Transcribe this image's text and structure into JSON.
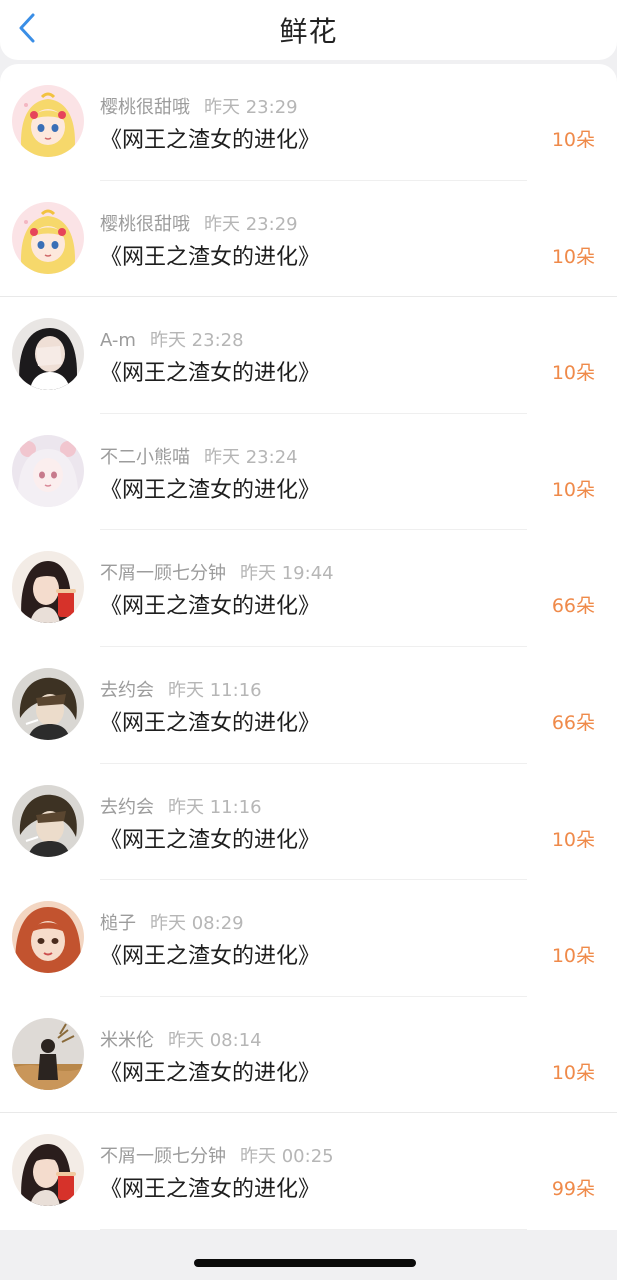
{
  "header": {
    "title": "鲜花",
    "back_icon": "chevron-left-icon",
    "accent": "#3a8ee6"
  },
  "colors": {
    "count": "#ef8a4a",
    "meta": "#9c9c9c"
  },
  "rows": [
    {
      "user": "樱桃很甜哦",
      "time": "昨天 23:29",
      "book": "《网王之渣女的进化》",
      "count": "10朵",
      "avatar": "anime-blonde-girl-avatar"
    },
    {
      "user": "樱桃很甜哦",
      "time": "昨天 23:29",
      "book": "《网王之渣女的进化》",
      "count": "10朵",
      "avatar": "anime-blonde-girl-avatar"
    },
    {
      "user": "A-m",
      "time": "昨天 23:28",
      "book": "《网王之渣女的进化》",
      "count": "10朵",
      "avatar": "girl-covering-face-avatar"
    },
    {
      "user": "不二小熊喵",
      "time": "昨天 23:24",
      "book": "《网王之渣女的进化》",
      "count": "10朵",
      "avatar": "pastel-anime-girl-avatar"
    },
    {
      "user": "不屑一顾七分钟",
      "time": "昨天 19:44",
      "book": "《网王之渣女的进化》",
      "count": "66朵",
      "avatar": "girl-with-drink-avatar"
    },
    {
      "user": "去约会",
      "time": "昨天 11:16",
      "book": "《网王之渣女的进化》",
      "count": "66朵",
      "avatar": "anime-man-avatar"
    },
    {
      "user": "去约会",
      "time": "昨天 11:16",
      "book": "《网王之渣女的进化》",
      "count": "10朵",
      "avatar": "anime-man-avatar"
    },
    {
      "user": "槌子",
      "time": "昨天 08:29",
      "book": "《网王之渣女的进化》",
      "count": "10朵",
      "avatar": "red-hair-girl-avatar"
    },
    {
      "user": "米米伦",
      "time": "昨天 08:14",
      "book": "《网王之渣女的进化》",
      "count": "10朵",
      "avatar": "person-in-field-avatar"
    },
    {
      "user": "不屑一顾七分钟",
      "time": "昨天 00:25",
      "book": "《网王之渣女的进化》",
      "count": "99朵",
      "avatar": "girl-with-drink-avatar"
    }
  ]
}
